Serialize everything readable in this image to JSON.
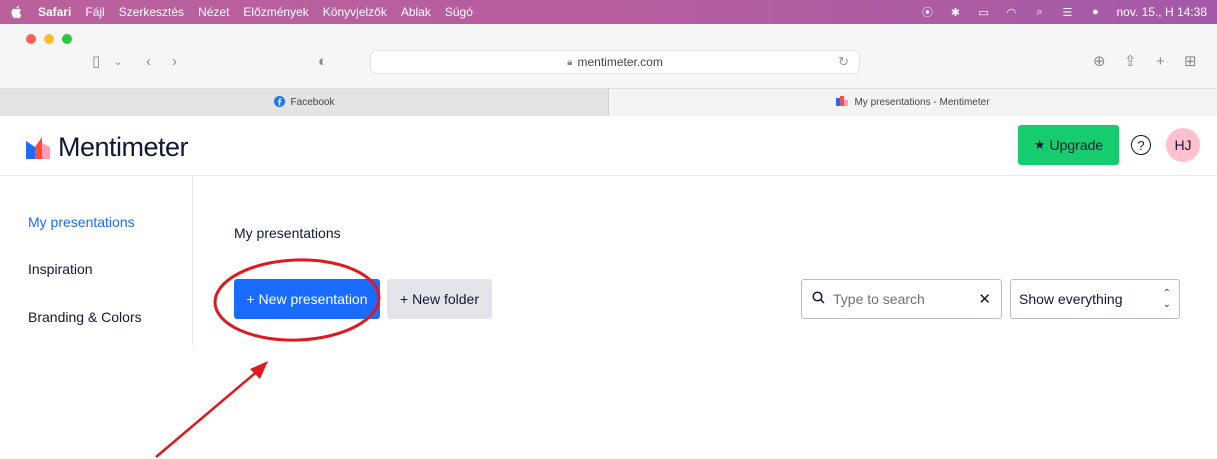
{
  "menubar": {
    "app": "Safari",
    "items": [
      "Fájl",
      "Szerkesztés",
      "Nézet",
      "Előzmények",
      "Könyvjelzők",
      "Ablak",
      "Súgó"
    ],
    "datetime": "nov. 15., H 14:38"
  },
  "browser": {
    "url": "mentimeter.com",
    "tabs": [
      {
        "title": "Facebook",
        "active": false
      },
      {
        "title": "My presentations - Mentimeter",
        "active": true
      }
    ]
  },
  "header": {
    "logo": "Mentimeter",
    "upgrade_label": "Upgrade",
    "help": "?",
    "avatar_initials": "HJ"
  },
  "sidebar": {
    "items": [
      {
        "label": "My presentations",
        "active": true
      },
      {
        "label": "Inspiration",
        "active": false
      },
      {
        "label": "Branding & Colors",
        "active": false
      }
    ]
  },
  "main": {
    "title": "My presentations",
    "new_presentation_label": "+ New presentation",
    "new_folder_label": "+ New folder",
    "search_placeholder": "Type to search",
    "filter_selected": "Show everything"
  },
  "colors": {
    "accent_blue": "#196cff",
    "upgrade_green": "#15cc6f",
    "annotation_red": "#e0191f"
  }
}
